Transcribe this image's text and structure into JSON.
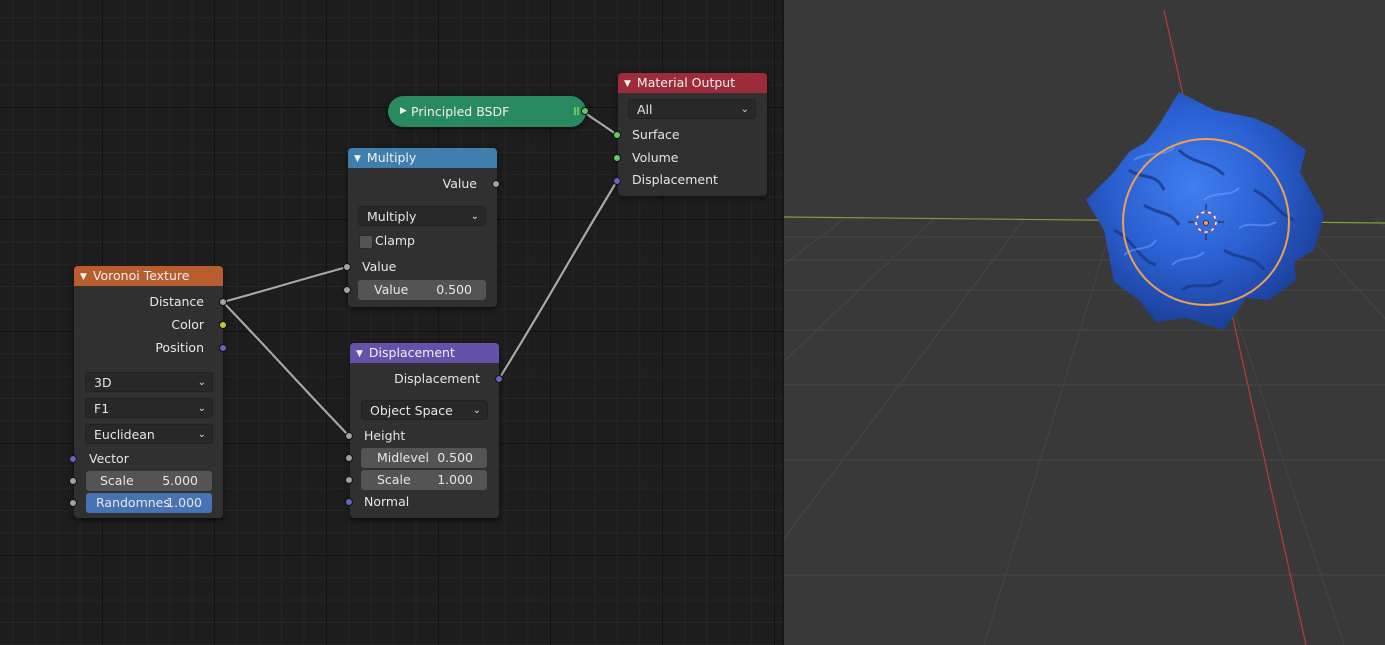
{
  "nodes": {
    "voronoi": {
      "title": "Voronoi Texture",
      "outputs": [
        "Distance",
        "Color",
        "Position"
      ],
      "dimensions": "3D",
      "feature": "F1",
      "metric": "Euclidean",
      "vector_label": "Vector",
      "scale": {
        "label": "Scale",
        "value": "5.000"
      },
      "randomness": {
        "label": "Randomnes",
        "value": "1.000"
      },
      "header_color": "#b85e2e"
    },
    "multiply": {
      "title": "Multiply",
      "output": "Value",
      "operation": "Multiply",
      "clamp_label": "Clamp",
      "clamp_checked": false,
      "input_label": "Value",
      "value_field": {
        "label": "Value",
        "value": "0.500"
      },
      "header_color": "#3f7fad"
    },
    "displacement": {
      "title": "Displacement",
      "output": "Displacement",
      "space": "Object Space",
      "height_label": "Height",
      "midlevel": {
        "label": "Midlevel",
        "value": "0.500"
      },
      "scale": {
        "label": "Scale",
        "value": "1.000"
      },
      "normal_label": "Normal",
      "header_color": "#6451aa"
    },
    "material_output": {
      "title": "Material Output",
      "target": "All",
      "inputs": [
        "Surface",
        "Volume",
        "Displacement"
      ],
      "header_color": "#9e2b39"
    },
    "principled": {
      "title": "Principled BSDF",
      "collapsed": true,
      "color": "#2a8a5f"
    }
  },
  "colors": {
    "socket_float": "#a1a1a1",
    "socket_color": "#c7c729",
    "socket_vector": "#6363c7",
    "socket_shader": "#63c763",
    "active_field": "#4772b3",
    "viewport_bg": "#393939",
    "object_blue": "#2a5fd0",
    "selection_orange": "#f0a050",
    "axis_x": "#b83a3a",
    "axis_y": "#7da13a"
  },
  "icons": [
    "collapse-triangle-icon",
    "expand-triangle-icon",
    "dropdown-chevron-icon",
    "3d-cursor-icon",
    "object-origin-icon"
  ]
}
